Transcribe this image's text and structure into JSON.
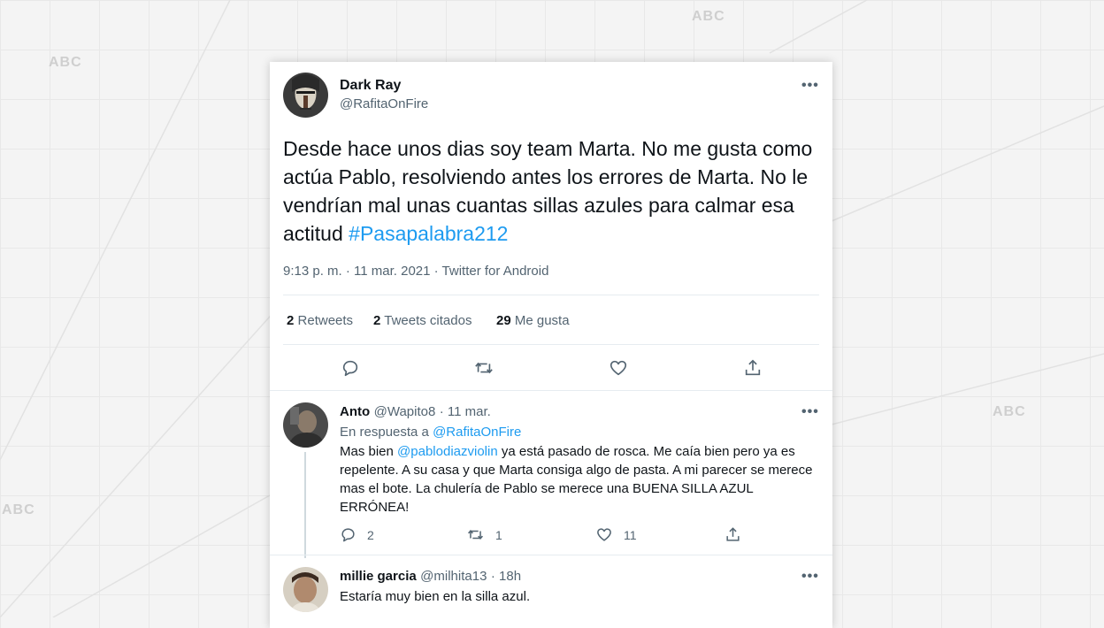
{
  "watermark": "ABC",
  "tweet": {
    "author": {
      "name": "Dark Ray",
      "handle": "@RafitaOnFire"
    },
    "more": "•••",
    "text": "Desde hace unos dias soy team Marta. No me gusta como actúa Pablo, resolviendo antes los errores de Marta. No le vendrían mal unas cuantas sillas azules para calmar esa actitud ",
    "hashtag": "#Pasapalabra212",
    "timestamp": "9:13 p. m. · 11 mar. 2021 · Twitter for Android",
    "stats": {
      "retweets_count": "2",
      "retweets_label": "Retweets",
      "quotes_count": "2",
      "quotes_label": "Tweets citados",
      "likes_count": "29",
      "likes_label": "Me gusta"
    },
    "actions": [
      "reply-icon",
      "retweet-icon",
      "like-icon",
      "share-icon"
    ]
  },
  "replies": [
    {
      "name": "Anto",
      "handle": "@Wapito8",
      "time": "· 11 mar.",
      "reply_to_label": "En respuesta a",
      "reply_to_handle": "@RafitaOnFire",
      "text_prefix": "Mas bien ",
      "mention": "@pablodiazviolin",
      "text_rest": " ya está pasado de rosca. Me caía bien pero ya es repelente. A su casa y que Marta consiga algo de pasta. A mi parecer se merece mas el bote. La chulería de Pablo se merece una BUENA SILLA AZUL ERRÓNEA!",
      "replies": "2",
      "retweets": "1",
      "likes": "11"
    },
    {
      "name": "millie garcia",
      "handle": "@milhita13",
      "time": "· 18h",
      "text": "Estaría muy bien en la silla azul."
    }
  ]
}
